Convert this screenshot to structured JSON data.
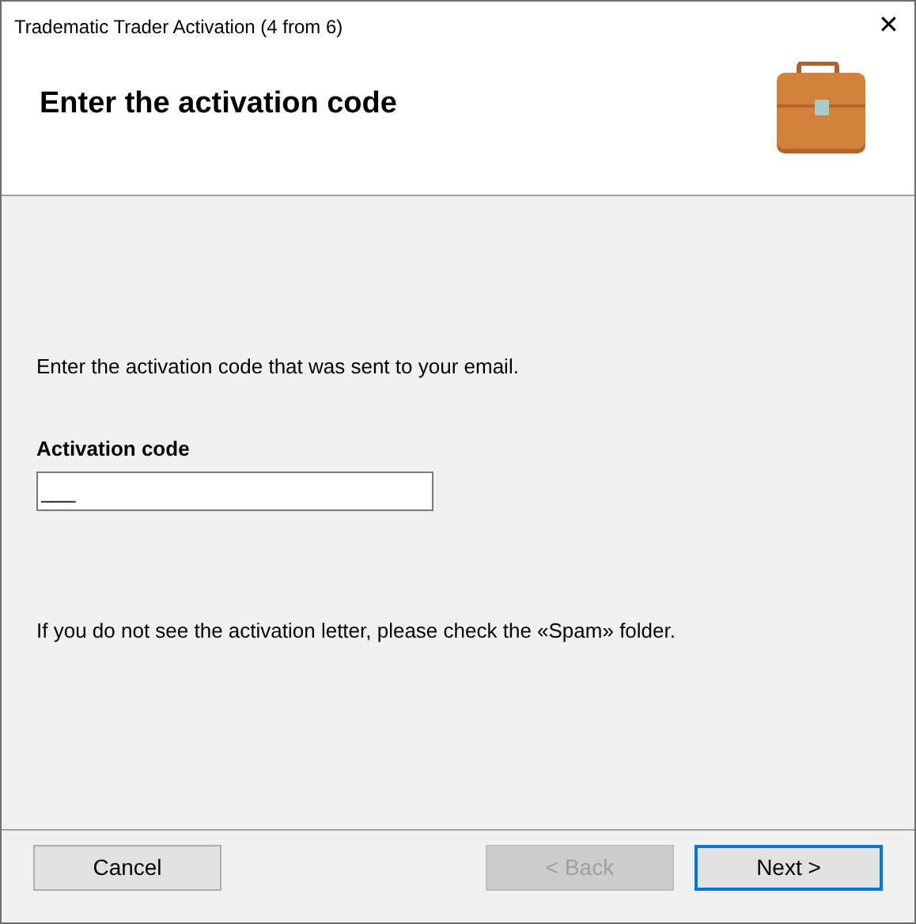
{
  "window": {
    "title": "Tradematic Trader Activation (4 from 6)",
    "close": "✕"
  },
  "header": {
    "title": "Enter the activation code"
  },
  "body": {
    "instruction": "Enter the activation code that was sent to your email.",
    "field": {
      "label": "Activation code",
      "value": "___"
    },
    "note": "If you do not see the activation letter, please check the «Spam» folder."
  },
  "buttons": [
    {
      "label": "Cancel",
      "disabled": false,
      "default": false
    },
    {
      "label": "< Back",
      "disabled": true,
      "default": false
    },
    {
      "label": "Next >",
      "disabled": false,
      "default": true
    }
  ]
}
